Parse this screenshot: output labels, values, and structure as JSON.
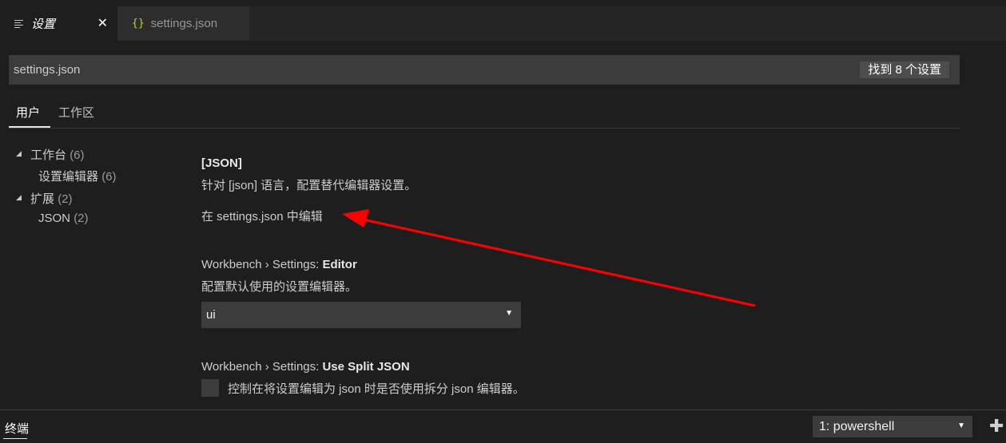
{
  "tabs": [
    {
      "label": "设置",
      "icon": "settings-lines-icon",
      "close": "✕"
    },
    {
      "label": "settings.json",
      "icon": "json-braces-icon",
      "icon_glyph": "{}"
    }
  ],
  "search": {
    "value": "settings.json",
    "result_count": "找到 8 个设置"
  },
  "scopes": [
    "用户",
    "工作区"
  ],
  "tree": [
    {
      "label": "工作台",
      "count": "(6)",
      "expanded": true
    },
    {
      "label": "设置编辑器",
      "count": "(6)"
    },
    {
      "label": "扩展",
      "count": "(2)",
      "expanded": true
    },
    {
      "label": "JSON",
      "count": "(2)"
    }
  ],
  "settings": {
    "json": {
      "title": "[JSON]",
      "description": "针对 [json] 语言，配置替代编辑器设置。",
      "edit_link": "在 settings.json 中编辑"
    },
    "editor": {
      "title_prefix": "Workbench › Settings: ",
      "title_name": "Editor",
      "description": "配置默认使用的设置编辑器。",
      "value": "ui"
    },
    "split_json": {
      "title_prefix": "Workbench › Settings: ",
      "title_name": "Use Split JSON",
      "description": "控制在将设置编辑为 json 时是否使用拆分 json 编辑器。"
    }
  },
  "panel": {
    "title": "终端",
    "terminal": "1: powershell",
    "add_glyph": "✚"
  },
  "colors": {
    "annotation_arrow": "#ff0000",
    "json_icon": "#cbcb41"
  }
}
